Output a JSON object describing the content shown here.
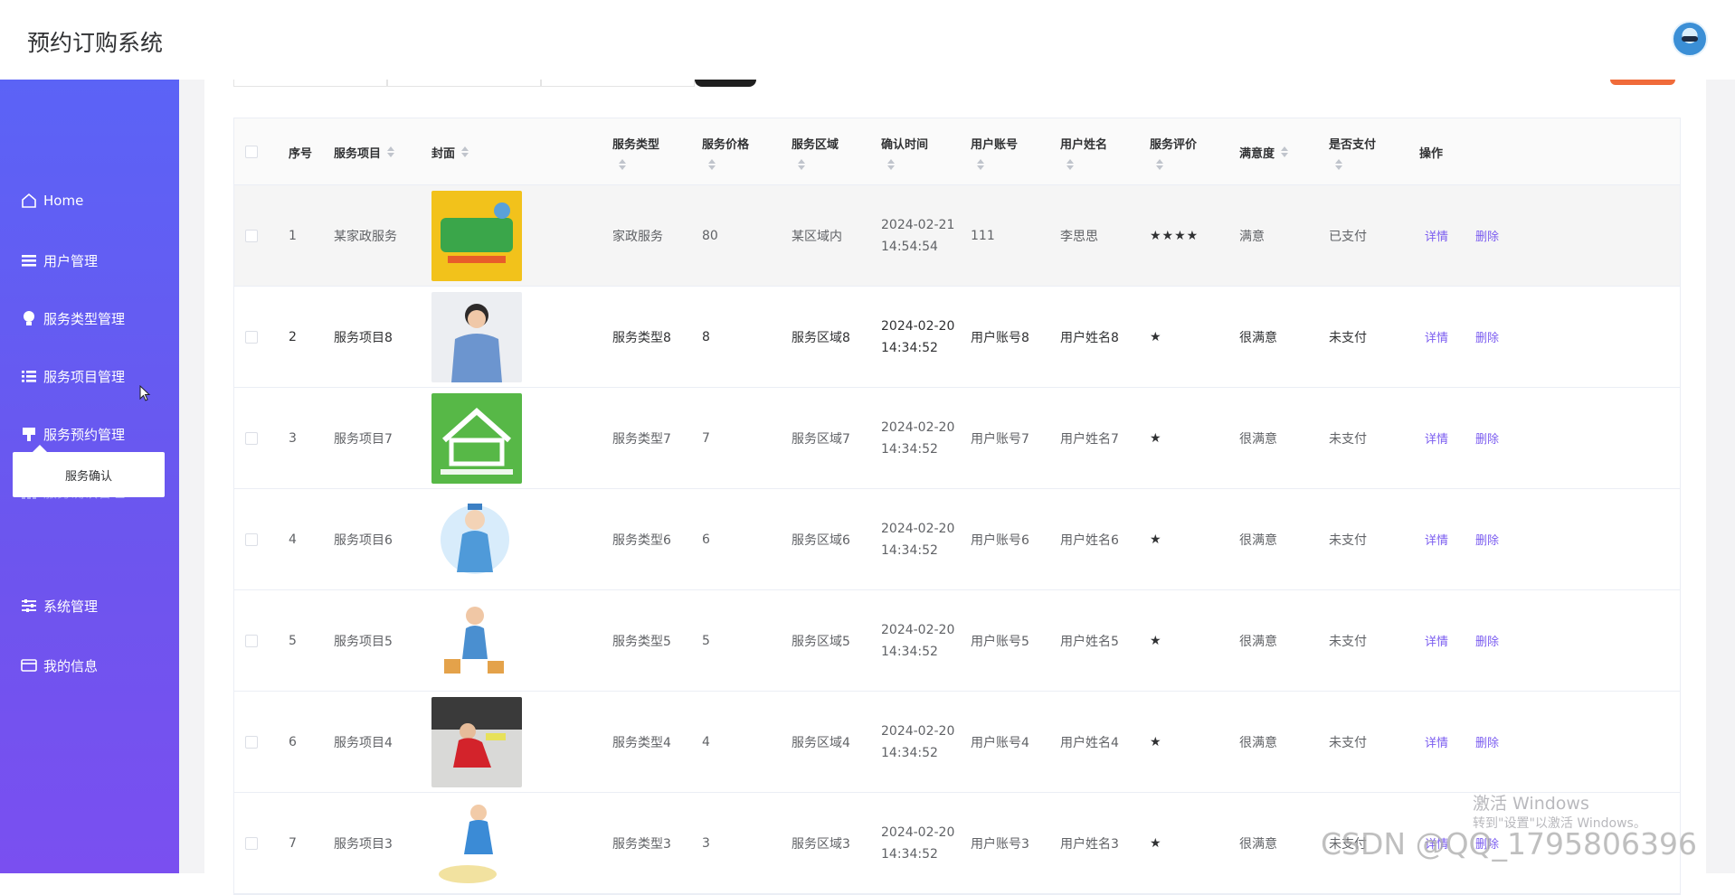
{
  "header": {
    "title": "预约订购系统"
  },
  "sidebar": {
    "items": [
      {
        "label": "Home",
        "icon": "home-icon"
      },
      {
        "label": "用户管理",
        "icon": "list-icon"
      },
      {
        "label": "服务类型管理",
        "icon": "bulb-icon"
      },
      {
        "label": "服务项目管理",
        "icon": "list-alt-icon"
      },
      {
        "label": "服务预约管理",
        "icon": "brush-icon"
      },
      {
        "label": "服务确认管理",
        "icon": "grid-icon"
      },
      {
        "label": "系统管理",
        "icon": "sliders-icon"
      },
      {
        "label": "我的信息",
        "icon": "card-icon"
      }
    ],
    "popup_item": "服务确认"
  },
  "table": {
    "headers": {
      "index": "序号",
      "item": "服务项目",
      "cover": "封面",
      "type": "服务类型",
      "price": "服务价格",
      "area": "服务区域",
      "confirm_time": "确认时间",
      "account": "用户账号",
      "name": "用户姓名",
      "rating": "服务评价",
      "satisfaction": "满意度",
      "paid": "是否支付",
      "ops": "操作"
    },
    "actions": {
      "detail": "详情",
      "delete": "删除"
    },
    "rows": [
      {
        "index": "1",
        "item": "某家政服务",
        "type": "家政服务",
        "price": "80",
        "area": "某区域内",
        "date": "2024-02-21",
        "time": "14:54:54",
        "account": "111",
        "name": "李思思",
        "rating": "★★★★",
        "satisfaction": "满意",
        "paid": "已支付"
      },
      {
        "index": "2",
        "item": "服务项目8",
        "type": "服务类型8",
        "price": "8",
        "area": "服务区域8",
        "date": "2024-02-20",
        "time": "14:34:52",
        "account": "用户账号8",
        "name": "用户姓名8",
        "rating": "★",
        "satisfaction": "很满意",
        "paid": "未支付"
      },
      {
        "index": "3",
        "item": "服务项目7",
        "type": "服务类型7",
        "price": "7",
        "area": "服务区域7",
        "date": "2024-02-20",
        "time": "14:34:52",
        "account": "用户账号7",
        "name": "用户姓名7",
        "rating": "★",
        "satisfaction": "很满意",
        "paid": "未支付"
      },
      {
        "index": "4",
        "item": "服务项目6",
        "type": "服务类型6",
        "price": "6",
        "area": "服务区域6",
        "date": "2024-02-20",
        "time": "14:34:52",
        "account": "用户账号6",
        "name": "用户姓名6",
        "rating": "★",
        "satisfaction": "很满意",
        "paid": "未支付"
      },
      {
        "index": "5",
        "item": "服务项目5",
        "type": "服务类型5",
        "price": "5",
        "area": "服务区域5",
        "date": "2024-02-20",
        "time": "14:34:52",
        "account": "用户账号5",
        "name": "用户姓名5",
        "rating": "★",
        "satisfaction": "很满意",
        "paid": "未支付"
      },
      {
        "index": "6",
        "item": "服务项目4",
        "type": "服务类型4",
        "price": "4",
        "area": "服务区域4",
        "date": "2024-02-20",
        "time": "14:34:52",
        "account": "用户账号4",
        "name": "用户姓名4",
        "rating": "★",
        "satisfaction": "很满意",
        "paid": "未支付"
      },
      {
        "index": "7",
        "item": "服务项目3",
        "type": "服务类型3",
        "price": "3",
        "area": "服务区域3",
        "date": "2024-02-20",
        "time": "14:34:52",
        "account": "用户账号3",
        "name": "用户姓名3",
        "rating": "★",
        "satisfaction": "很满意",
        "paid": "未支付"
      }
    ]
  },
  "watermark": {
    "windows_line1": "激活 Windows",
    "windows_line2": "转到\"设置\"以激活 Windows。",
    "csdn": "CSDN @QQ_1795806396"
  },
  "colors": {
    "sidebar_top": "#5b63f6",
    "sidebar_bottom": "#7a4ff0",
    "action": "#7b5cf0",
    "danger_button": "#f06b3a"
  }
}
